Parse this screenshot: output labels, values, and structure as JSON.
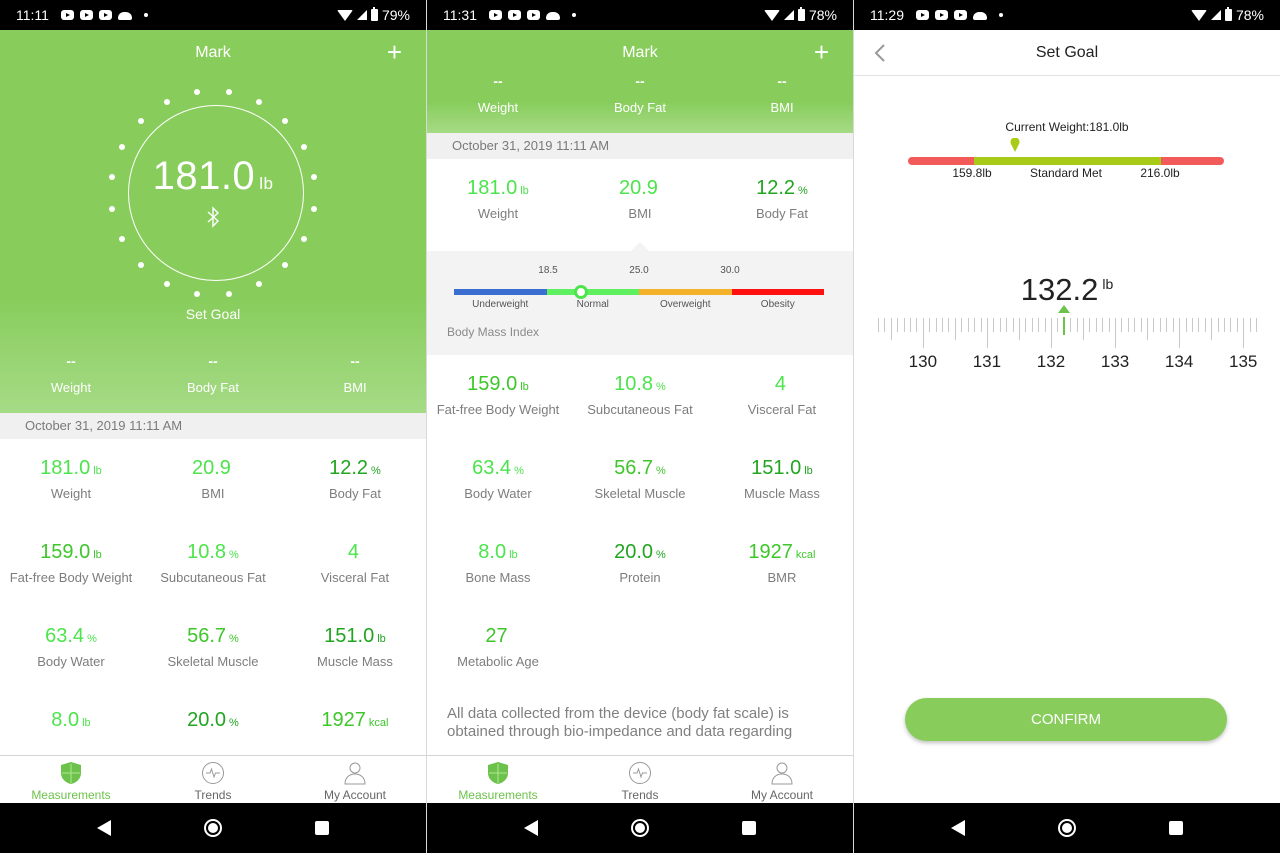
{
  "colors": {
    "brand_green": "#88cd5c",
    "value_green_light": "#4ce44c",
    "value_green_mid": "#3ec62a",
    "value_green_dark": "#21a521",
    "nav_active": "#6cc24a"
  },
  "screens": [
    {
      "status": {
        "time": "11:11",
        "battery": "79%"
      },
      "header": {
        "title": "Mark",
        "add_icon": "plus-icon"
      },
      "dial": {
        "value": "181.0",
        "unit": "lb",
        "bt_icon": "bluetooth-icon",
        "set_goal": "Set Goal"
      },
      "summary": [
        {
          "value": "--",
          "label": "Weight"
        },
        {
          "value": "--",
          "label": "Body Fat"
        },
        {
          "value": "--",
          "label": "BMI"
        }
      ],
      "date": "October 31, 2019 11:11 AM",
      "metrics": [
        {
          "value": "181.0",
          "unit": "lb",
          "label": "Weight",
          "tone": "c1"
        },
        {
          "value": "20.9",
          "unit": "",
          "label": "BMI",
          "tone": "c1"
        },
        {
          "value": "12.2",
          "unit": "%",
          "label": "Body Fat",
          "tone": "c3"
        },
        {
          "value": "159.0",
          "unit": "lb",
          "label": "Fat-free Body Weight",
          "tone": "c2"
        },
        {
          "value": "10.8",
          "unit": "%",
          "label": "Subcutaneous Fat",
          "tone": "c1"
        },
        {
          "value": "4",
          "unit": "",
          "label": "Visceral Fat",
          "tone": "c1"
        },
        {
          "value": "63.4",
          "unit": "%",
          "label": "Body Water",
          "tone": "c1"
        },
        {
          "value": "56.7",
          "unit": "%",
          "label": "Skeletal Muscle",
          "tone": "c2"
        },
        {
          "value": "151.0",
          "unit": "lb",
          "label": "Muscle Mass",
          "tone": "c3"
        },
        {
          "value": "8.0",
          "unit": "lb",
          "label": "",
          "tone": "c1"
        },
        {
          "value": "20.0",
          "unit": "%",
          "label": "",
          "tone": "c3"
        },
        {
          "value": "1927",
          "unit": "kcal",
          "label": "",
          "tone": "c2"
        }
      ]
    },
    {
      "status": {
        "time": "11:31",
        "battery": "78%"
      },
      "header": {
        "title": "Mark",
        "add_icon": "plus-icon"
      },
      "summary": [
        {
          "value": "--",
          "label": "Weight"
        },
        {
          "value": "--",
          "label": "Body Fat"
        },
        {
          "value": "--",
          "label": "BMI"
        }
      ],
      "date": "October 31, 2019 11:11 AM",
      "top_metrics": [
        {
          "value": "181.0",
          "unit": "lb",
          "label": "Weight",
          "tone": "c1"
        },
        {
          "value": "20.9",
          "unit": "",
          "label": "BMI",
          "tone": "c1"
        },
        {
          "value": "12.2",
          "unit": "%",
          "label": "Body Fat",
          "tone": "c3"
        }
      ],
      "bmi_scale": {
        "title": "Body Mass Index",
        "thresholds": [
          "18.5",
          "25.0",
          "30.0"
        ],
        "categories": [
          {
            "label": "Underweight",
            "color": "#3a6fd1"
          },
          {
            "label": "Normal",
            "color": "#5ef05e"
          },
          {
            "label": "Overweight",
            "color": "#f4b12a"
          },
          {
            "label": "Obesity",
            "color": "#ff1111"
          }
        ],
        "current_bmi": 20.9
      },
      "metrics": [
        {
          "value": "159.0",
          "unit": "lb",
          "label": "Fat-free Body Weight",
          "tone": "c2"
        },
        {
          "value": "10.8",
          "unit": "%",
          "label": "Subcutaneous Fat",
          "tone": "c1"
        },
        {
          "value": "4",
          "unit": "",
          "label": "Visceral Fat",
          "tone": "c1"
        },
        {
          "value": "63.4",
          "unit": "%",
          "label": "Body Water",
          "tone": "c1"
        },
        {
          "value": "56.7",
          "unit": "%",
          "label": "Skeletal Muscle",
          "tone": "c2"
        },
        {
          "value": "151.0",
          "unit": "lb",
          "label": "Muscle Mass",
          "tone": "c3"
        },
        {
          "value": "8.0",
          "unit": "lb",
          "label": "Bone Mass",
          "tone": "c1"
        },
        {
          "value": "20.0",
          "unit": "%",
          "label": "Protein",
          "tone": "c3"
        },
        {
          "value": "1927",
          "unit": "kcal",
          "label": "BMR",
          "tone": "c2"
        },
        {
          "value": "27",
          "unit": "",
          "label": "Metabolic Age",
          "tone": "c2"
        }
      ],
      "disclaimer": "All data collected from the device (body fat scale) is obtained through bio-impedance and data regarding"
    },
    {
      "status": {
        "time": "11:29",
        "battery": "78%"
      },
      "topbar": {
        "title": "Set Goal",
        "back_icon": "chevron-left-icon"
      },
      "current_weight_label": "Current Weight:181.0lb",
      "range": {
        "low": "159.8lb",
        "middle": "Standard Met",
        "high": "216.0lb",
        "current_position": 0.34,
        "segments": [
          {
            "color": "#f35b5b",
            "fraction": 0.21
          },
          {
            "color": "#a8cb17",
            "fraction": 0.59
          },
          {
            "color": "#f35b5b",
            "fraction": 0.2
          }
        ]
      },
      "goal": {
        "value": "132.2",
        "unit": "lb"
      },
      "ruler": {
        "min": 129.3,
        "max": 135.2,
        "labels": [
          "130",
          "131",
          "132",
          "133",
          "134",
          "135"
        ],
        "selected": 132.2
      },
      "confirm_label": "CONFIRM"
    }
  ],
  "bottom_nav": [
    {
      "label": "Measurements",
      "icon": "shield-icon",
      "active": true
    },
    {
      "label": "Trends",
      "icon": "pulse-icon",
      "active": false
    },
    {
      "label": "My Account",
      "icon": "person-icon",
      "active": false
    }
  ]
}
